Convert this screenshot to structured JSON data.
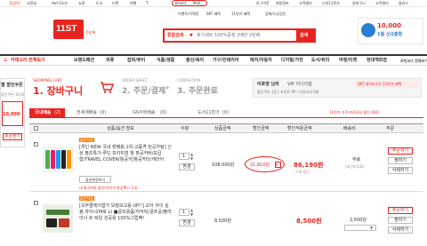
{
  "top_left_links": [
    "11번가",
    "쇼킹딜",
    "Hot Click",
    "쇼핑",
    "도서",
    "티켓",
    "여행",
    "T",
    "Brand",
    "Mall"
  ],
  "top_right_links": [
    "로그아웃",
    "회원정보",
    "고객센터",
    "나의11번가",
    "장바구니",
    "고객센터",
    "플러스"
  ],
  "gnb_row2": [
    "이벤트/기획전",
    "SKT 혜택",
    "11번가 혜택",
    "업체/소상공인"
  ],
  "logo": {
    "text": "11ST",
    "sub": "전상계"
  },
  "search": {
    "category": "통합검색",
    "placeholder": "휴가세트 100%증정 2배만 2탄배",
    "button": "검색"
  },
  "promo": {
    "amount": "10,000",
    "label": "1월 신규출항"
  },
  "nav": [
    "카테고리 전체보기",
    "브랜드패션",
    "의류",
    "잡화/뷰티",
    "식품/생활",
    "출산/육아",
    "가구/인테리어",
    "레저/자동차",
    "디지털/가전",
    "도서/취미",
    "여행/티켓",
    "현대백화점",
    "추천코너 전체보기"
  ],
  "side": {
    "title": "웹 할인쿠폰",
    "sub": "할인쿠폰 10,000",
    "amount": "10,000",
    "coupon_btn": "쿠폰받기"
  },
  "steps": {
    "step1_label": "1. 장바구니",
    "step1_en": "SHOPPING CART",
    "step2_label": "2. 주문/결제",
    "step2_en": "ORDER SHEET",
    "step3_label": "3. 주문완료",
    "step3_en": "COMPLETION"
  },
  "user": {
    "greet": "이호영 님의",
    "grade": "VIP 이나이잡",
    "benefit": "할인쿠폰 1장 / 포인트 0P / 마일리지 0원"
  },
  "sk_banner": "SKT 데이터소득 11번가 혜택",
  "tabs": [
    "국내배송",
    "전세계배송",
    "GS수퍼배송",
    "도서11번가"
  ],
  "tab_counts": [
    "(2)",
    "(0)",
    "(0)",
    "(0)"
  ],
  "notice": "11번가 가격 프로모션 할인 (AD)",
  "table_headers": [
    "상품/옵션 정보",
    "수량",
    "상품금액",
    "할인금액",
    "할인적용금액",
    "배송비",
    "주문"
  ],
  "items": [
    {
      "badge": "할인적용",
      "name": "[루딘 NEW 국내 판매용 1위-고품격 탄공카탐] 신상 짱초특가-루딘 프리미엄 월 항공커버/보급형/TRAVEL COVER/항공카/항공카터/캐리어",
      "option": "옵션변경하기",
      "extra": "내 항공위원 할인(이하의 항공팩) / 1개",
      "qty": "1",
      "qty_btn": "변경",
      "price": "108,000원",
      "discount": "21,810원",
      "final": "86,190원",
      "final_note": "구매 할인",
      "shipping": "무료",
      "shipping_note": "(조건부무료)",
      "buttons": [
        "주문하기",
        "찜하기",
        "삭제하기"
      ]
    },
    {
      "badge": "할인적용",
      "name": "[오무클레이잡가 모질모고를 UP!!] 오아 아이 실봉 라이너(M로 L) ■골프용품/자석틱/골프공/볼라이너 르 레일 성공용 100%그립팩!",
      "option": "",
      "extra": "",
      "qty": "1",
      "qty_btn": "변경",
      "price": "8,500원",
      "discount": "",
      "final": "8,500원",
      "final_note": "",
      "shipping": "2,500원",
      "shipping_note": "",
      "buttons": [
        "주문하기",
        "찜하기",
        "삭제하기"
      ]
    }
  ],
  "colors": {
    "accent": "#e8241f",
    "nav_border": "#333333",
    "header_bg": "#f2f2f2",
    "badge": "#ff7800"
  }
}
